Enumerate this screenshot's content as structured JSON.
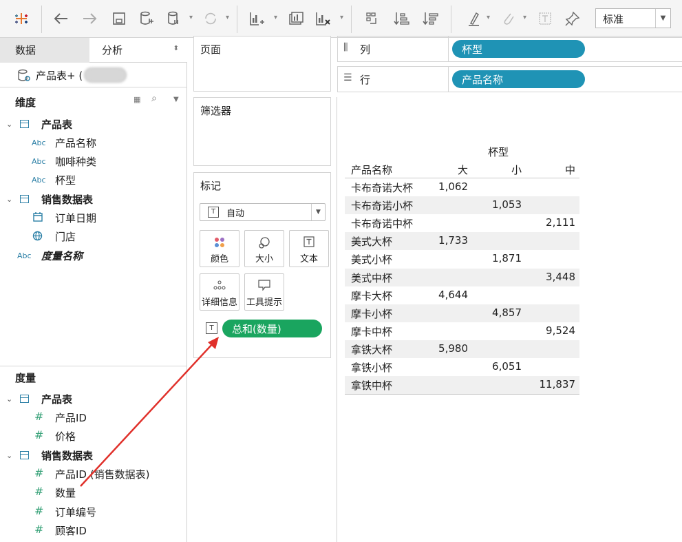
{
  "toolbar": {
    "icons": [
      "tableau-logo-icon",
      "back-icon",
      "forward-icon",
      "save-icon",
      "new-datasource-icon",
      "pause-datasource-icon",
      "refresh-icon",
      "new-worksheet-icon",
      "duplicate-sheet-icon",
      "clear-sheet-icon",
      "swap-icon",
      "sort-asc-icon",
      "sort-desc-icon",
      "highlight-icon",
      "clip-icon",
      "text-icon",
      "pin-icon"
    ],
    "fit_mode": "标准"
  },
  "left_panel": {
    "tab_data": "数据",
    "tab_analysis": "分析",
    "datasource_label": "产品表+ (",
    "dimensions_title": "维度",
    "measures_title": "度量",
    "dimensions": [
      {
        "group": "产品表",
        "fields": [
          {
            "type": "Abc",
            "name": "产品名称"
          },
          {
            "type": "Abc",
            "name": "咖啡种类"
          },
          {
            "type": "Abc",
            "name": "杯型"
          }
        ]
      },
      {
        "group": "销售数据表",
        "fields": [
          {
            "type": "date",
            "name": "订单日期"
          },
          {
            "type": "geo",
            "name": "门店"
          }
        ]
      },
      {
        "group": "",
        "fields": [
          {
            "type": "Abc",
            "name": "度量名称"
          }
        ]
      }
    ],
    "measures": [
      {
        "group": "产品表",
        "fields": [
          {
            "type": "#",
            "name": "产品ID"
          },
          {
            "type": "#",
            "name": "价格"
          }
        ]
      },
      {
        "group": "销售数据表",
        "fields": [
          {
            "type": "#",
            "name": "产品ID (销售数据表)"
          },
          {
            "type": "#",
            "name": "数量"
          },
          {
            "type": "#",
            "name": "订单编号"
          },
          {
            "type": "#",
            "name": "顾客ID"
          }
        ]
      }
    ]
  },
  "shelves": {
    "pages": "页面",
    "filters": "筛选器",
    "marks": "标记",
    "marks_type": "自动",
    "marks_buttons": [
      "颜色",
      "大小",
      "文本",
      "详细信息",
      "工具提示"
    ],
    "marks_pill": "总和(数量)",
    "columns_label": "列",
    "columns_pill": "杯型",
    "rows_label": "行",
    "rows_pill": "产品名称"
  },
  "crosstab": {
    "column_header": "杯型",
    "row_header": "产品名称",
    "columns": [
      "大",
      "小",
      "中"
    ],
    "rows": [
      {
        "name": "卡布奇诺大杯",
        "大": "1,062",
        "小": "",
        "中": ""
      },
      {
        "name": "卡布奇诺小杯",
        "大": "",
        "小": "1,053",
        "中": ""
      },
      {
        "name": "卡布奇诺中杯",
        "大": "",
        "小": "",
        "中": "2,111"
      },
      {
        "name": "美式大杯",
        "大": "1,733",
        "小": "",
        "中": ""
      },
      {
        "name": "美式小杯",
        "大": "",
        "小": "1,871",
        "中": ""
      },
      {
        "name": "美式中杯",
        "大": "",
        "小": "",
        "中": "3,448"
      },
      {
        "name": "摩卡大杯",
        "大": "4,644",
        "小": "",
        "中": ""
      },
      {
        "name": "摩卡小杯",
        "大": "",
        "小": "4,857",
        "中": ""
      },
      {
        "name": "摩卡中杯",
        "大": "",
        "小": "",
        "中": "9,524"
      },
      {
        "name": "拿铁大杯",
        "大": "5,980",
        "小": "",
        "中": ""
      },
      {
        "name": "拿铁小杯",
        "大": "",
        "小": "6,051",
        "中": ""
      },
      {
        "name": "拿铁中杯",
        "大": "",
        "小": "",
        "中": "11,837"
      }
    ]
  },
  "annotation": {
    "arrow_color": "#e0302a"
  },
  "colors": {
    "pill_blue": "#1f93b5",
    "pill_green": "#1aa55f",
    "field_blue": "#2b7fa6",
    "measure_green": "#3aa37a"
  }
}
